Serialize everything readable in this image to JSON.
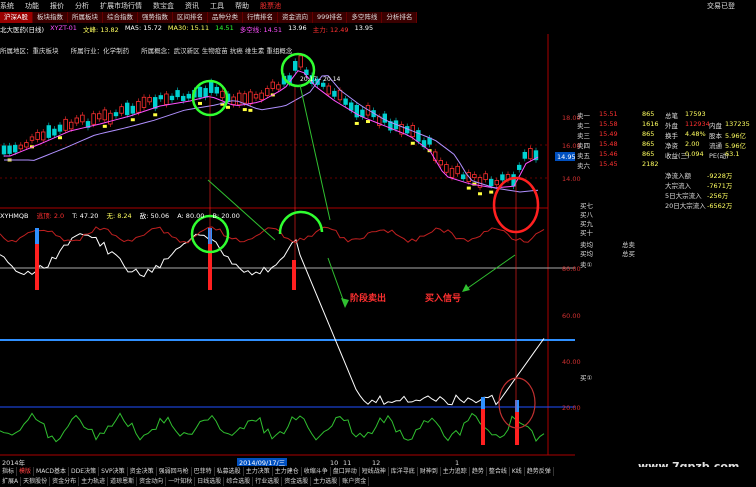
{
  "menu": {
    "items": [
      "系统",
      "功能",
      "报价",
      "分析",
      "扩展市场行情",
      "资讯",
      "工具",
      "帮助"
    ],
    "app_items": [
      "数宝盒",
      "股票池"
    ],
    "right_link": "交易已登"
  },
  "tabs": [
    "沪深A股",
    "板块指数",
    "所属板块",
    "综合指数",
    "强势指数",
    "区间排名",
    "品种分类",
    "行情排名",
    "资金流向",
    "999排名",
    "多空阵线",
    "分析排名"
  ],
  "info": {
    "stock": "北大医药(日线)",
    "xyzt": "XYZT-01",
    "wenfeng": "文峰: 13.82",
    "ma5": "MA5: 15.72",
    "ma30": "MA30: 15.11",
    "up": "14.51",
    "duokong": "多空线: 14.51",
    "duokong_val": "13.96",
    "zhuli": "主力: 12.49",
    "zhuli_val": "13.95"
  },
  "sector": {
    "region": "所属地区：重庆板块",
    "industry": "所属行业：化学制药",
    "concept": "所属概念：武汉新区 生物疫苗 抗癌 维生素 重组概念"
  },
  "price_labels": {
    "high": "20.17",
    "low": "20.14"
  },
  "axis_main": [
    "18.00",
    "16.00",
    "14.00"
  ],
  "cur_price": "14.95",
  "indicator": {
    "name": "XYHMQB",
    "t": "T: 47.20",
    "l": "无: 8.24",
    "r": "敌: 50.06",
    "a": "A: 80.00",
    "b": "B: 20.00",
    "signal": "逃顶: 2.0"
  },
  "axis_ind": [
    "80.00",
    "60.00",
    "40.00",
    "20.00"
  ],
  "annotations": {
    "sell": "阶段卖出",
    "buy": "买入信号"
  },
  "date_axis": {
    "y2014": "2014年",
    "date": "2014/09/17/三",
    "m10": "10",
    "m11": "11",
    "m12": "12",
    "m1": "1"
  },
  "panel": {
    "asks": [
      {
        "label": "卖一",
        "price": "15.51",
        "vol": "865"
      },
      {
        "label": "卖二",
        "price": "15.58",
        "vol": "1616"
      },
      {
        "label": "卖三",
        "price": "15.49",
        "vol": "865"
      },
      {
        "label": "卖四",
        "price": "15.48",
        "vol": "865"
      },
      {
        "label": "卖五",
        "price": "15.46",
        "vol": "865"
      },
      {
        "label": "卖六",
        "price": "15.45",
        "vol": "2182"
      }
    ],
    "stats": [
      {
        "k": "总笔",
        "v": "17593"
      },
      {
        "k": "外盘",
        "v": "112934"
      },
      {
        "k": "换手",
        "v": "4.48%"
      },
      {
        "k": "净资",
        "v": "2.00"
      },
      {
        "k": "收益(三)",
        "v": "0.094"
      }
    ],
    "stats_right": [
      {
        "k": "内盘",
        "v": "137235"
      },
      {
        "k": "股本",
        "v": "5.96亿"
      },
      {
        "k": "流通",
        "v": "5.96亿"
      },
      {
        "k": "PE(动)",
        "v": "63.1"
      }
    ],
    "flows": [
      {
        "k": "净流入额",
        "v": "-9228万"
      },
      {
        "k": "大宗流入",
        "v": "-7671万"
      },
      {
        "k": "5日大宗流入",
        "v": "-256万"
      },
      {
        "k": "20日大宗流入",
        "v": "-6562万"
      }
    ],
    "bid_labels": [
      "买七",
      "买八",
      "买九",
      "买十"
    ],
    "mid": [
      {
        "l": "卖均",
        "r": "总卖"
      },
      {
        "l": "买均",
        "r": "总买"
      }
    ],
    "sell_label": "卖①",
    "buy_label": "买①"
  },
  "bottom1": [
    "指标",
    "模版",
    "MACD基本",
    "DDE决策",
    "SVP决策",
    "资金决策",
    "强弱回马枪",
    "巴菲特",
    "私募选股",
    "主力决策",
    "主力建仓",
    "收缩斗争",
    "盘口异动",
    "短线战神",
    "库洋寻底",
    "财神到",
    "主力追踪",
    "趋势",
    "整合线",
    "K线",
    "趋势反弹"
  ],
  "bottom2": [
    "扩展A",
    "天狼股份",
    "资金分布",
    "主力轨迹",
    "道琼恩斯",
    "资金动向",
    "一叶知秋",
    "日线选股",
    "综合选股",
    "行业选股",
    "资金选股",
    "主力选股",
    "账户资金"
  ],
  "watermark": "www.7gpzb.com",
  "colors": {
    "up": "#ff3030",
    "down": "#00e0e0",
    "ma_magenta": "#ff50ff",
    "ma_purple": "#b090ff",
    "green_circle": "#30ff30",
    "red_circle": "#ff2020",
    "white": "#ffffff",
    "blue_line": "#3090ff"
  }
}
